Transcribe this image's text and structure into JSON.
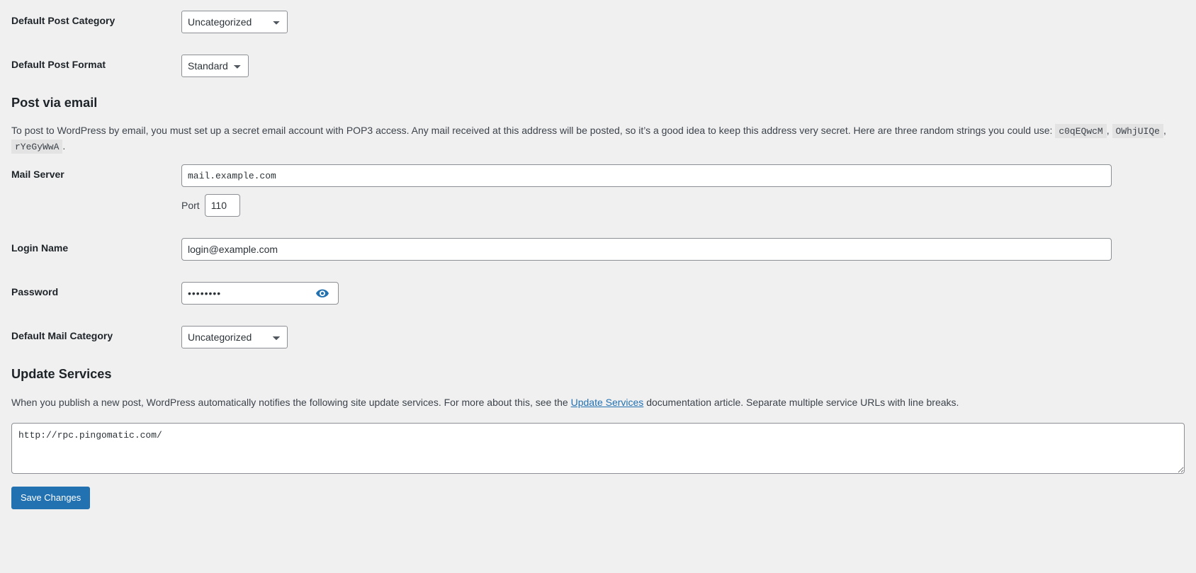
{
  "settings_rows": {
    "default_post_category": {
      "label": "Default Post Category",
      "value": "Uncategorized",
      "options": [
        "Uncategorized"
      ]
    },
    "default_post_format": {
      "label": "Default Post Format",
      "value": "Standard",
      "options": [
        "Standard"
      ]
    },
    "mail_server": {
      "label": "Mail Server",
      "value": "mail.example.com",
      "port_label": "Port",
      "port_value": "110"
    },
    "login_name": {
      "label": "Login Name",
      "value": "login@example.com"
    },
    "password": {
      "label": "Password",
      "value": "••••••••",
      "toggle_icon": "eye-icon"
    },
    "default_mail_category": {
      "label": "Default Mail Category",
      "value": "Uncategorized",
      "options": [
        "Uncategorized"
      ]
    }
  },
  "post_via_email": {
    "title": "Post via email",
    "desc_part1": "To post to WordPress by email, you must set up a secret email account with POP3 access. Any mail received at this address will be posted, so it’s a good idea to keep this address very secret. Here are three random strings you could use:",
    "code1": "c0qEQwcM",
    "sep1": ",",
    "code2": "OWhjUIQe",
    "sep2": ",",
    "code3": "rYeGyWwA",
    "sep3": "."
  },
  "update_services": {
    "title": "Update Services",
    "desc_before_link": "When you publish a new post, WordPress automatically notifies the following site update services. For more about this, see the",
    "link_text": "Update Services",
    "desc_after_link": "documentation article. Separate multiple service URLs with line breaks.",
    "textarea_value": "http://rpc.pingomatic.com/"
  },
  "submit": {
    "save_label": "Save Changes"
  },
  "colors": {
    "accent": "#2271b1",
    "background": "#f0f0f1",
    "text": "#3c434a",
    "heading": "#1d2327",
    "border": "#8c8f94"
  }
}
